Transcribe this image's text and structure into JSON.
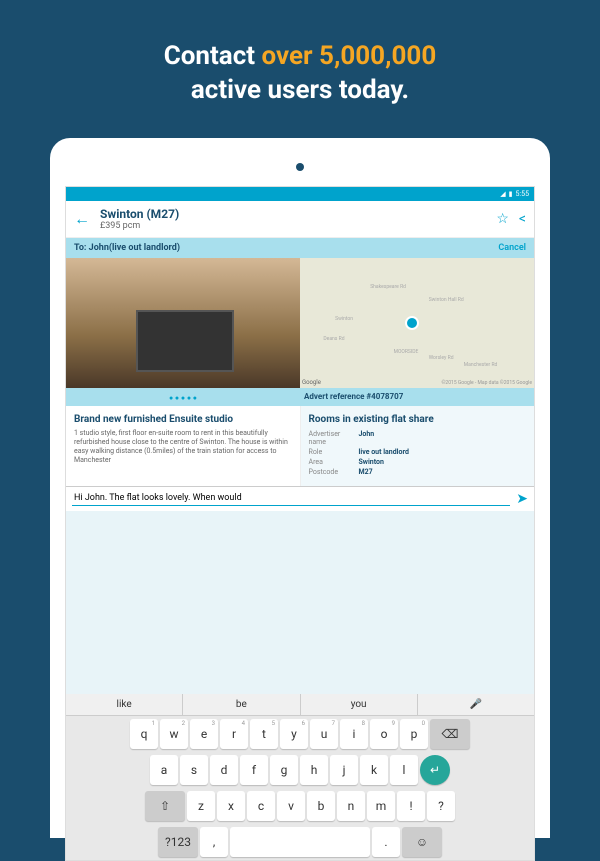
{
  "hero": {
    "line1_pre": "Contact ",
    "line1_hl": "over 5,000,000",
    "line2": "active users today."
  },
  "statusbar": {
    "time": "5:55"
  },
  "header": {
    "location": "Swinton (M27)",
    "price": "£395 pcm"
  },
  "tobar": {
    "to": "To: John(live out landlord)",
    "cancel": "Cancel"
  },
  "map": {
    "attribution": "©2015 Google - Map data ©2015 Google",
    "logo": "Google",
    "streets": [
      "Shakespeare Rd",
      "Swinton Hall Rd",
      "Swinton",
      "Deans Rd",
      "MOORSIDE",
      "Worsley Rd",
      "Manchester Rd"
    ]
  },
  "advert_ref": "Advert reference #4078707",
  "listing": {
    "title": "Brand new furnished Ensuite studio",
    "desc": "1 studio style, first floor en-suite room to rent in this beautifully refurbished house close to the centre of Swinton. The house is within easy walking distance (0.5miles) of the train station for access to Manchester"
  },
  "rooms_title": "Rooms in existing flat share",
  "details": {
    "advertiser_lbl": "Advertiser name",
    "advertiser": "John",
    "role_lbl": "Role",
    "role": "live out landlord",
    "area_lbl": "Area",
    "area": "Swinton",
    "postcode_lbl": "Postcode",
    "postcode": "M27"
  },
  "message": {
    "value": "Hi John. The flat looks lovely. When would"
  },
  "suggestions": [
    "like",
    "be",
    "you"
  ],
  "keyboard": {
    "r1": [
      [
        "q",
        "1"
      ],
      [
        "w",
        "2"
      ],
      [
        "e",
        "3"
      ],
      [
        "r",
        "4"
      ],
      [
        "t",
        "5"
      ],
      [
        "y",
        "6"
      ],
      [
        "u",
        "7"
      ],
      [
        "i",
        "8"
      ],
      [
        "o",
        "9"
      ],
      [
        "p",
        "0"
      ]
    ],
    "r2": [
      "a",
      "s",
      "d",
      "f",
      "g",
      "h",
      "j",
      "k",
      "l"
    ],
    "r3": [
      "z",
      "x",
      "c",
      "v",
      "b",
      "n",
      "m",
      "!",
      "?"
    ],
    "sym": "?123",
    "comma": ",",
    "period": "."
  }
}
